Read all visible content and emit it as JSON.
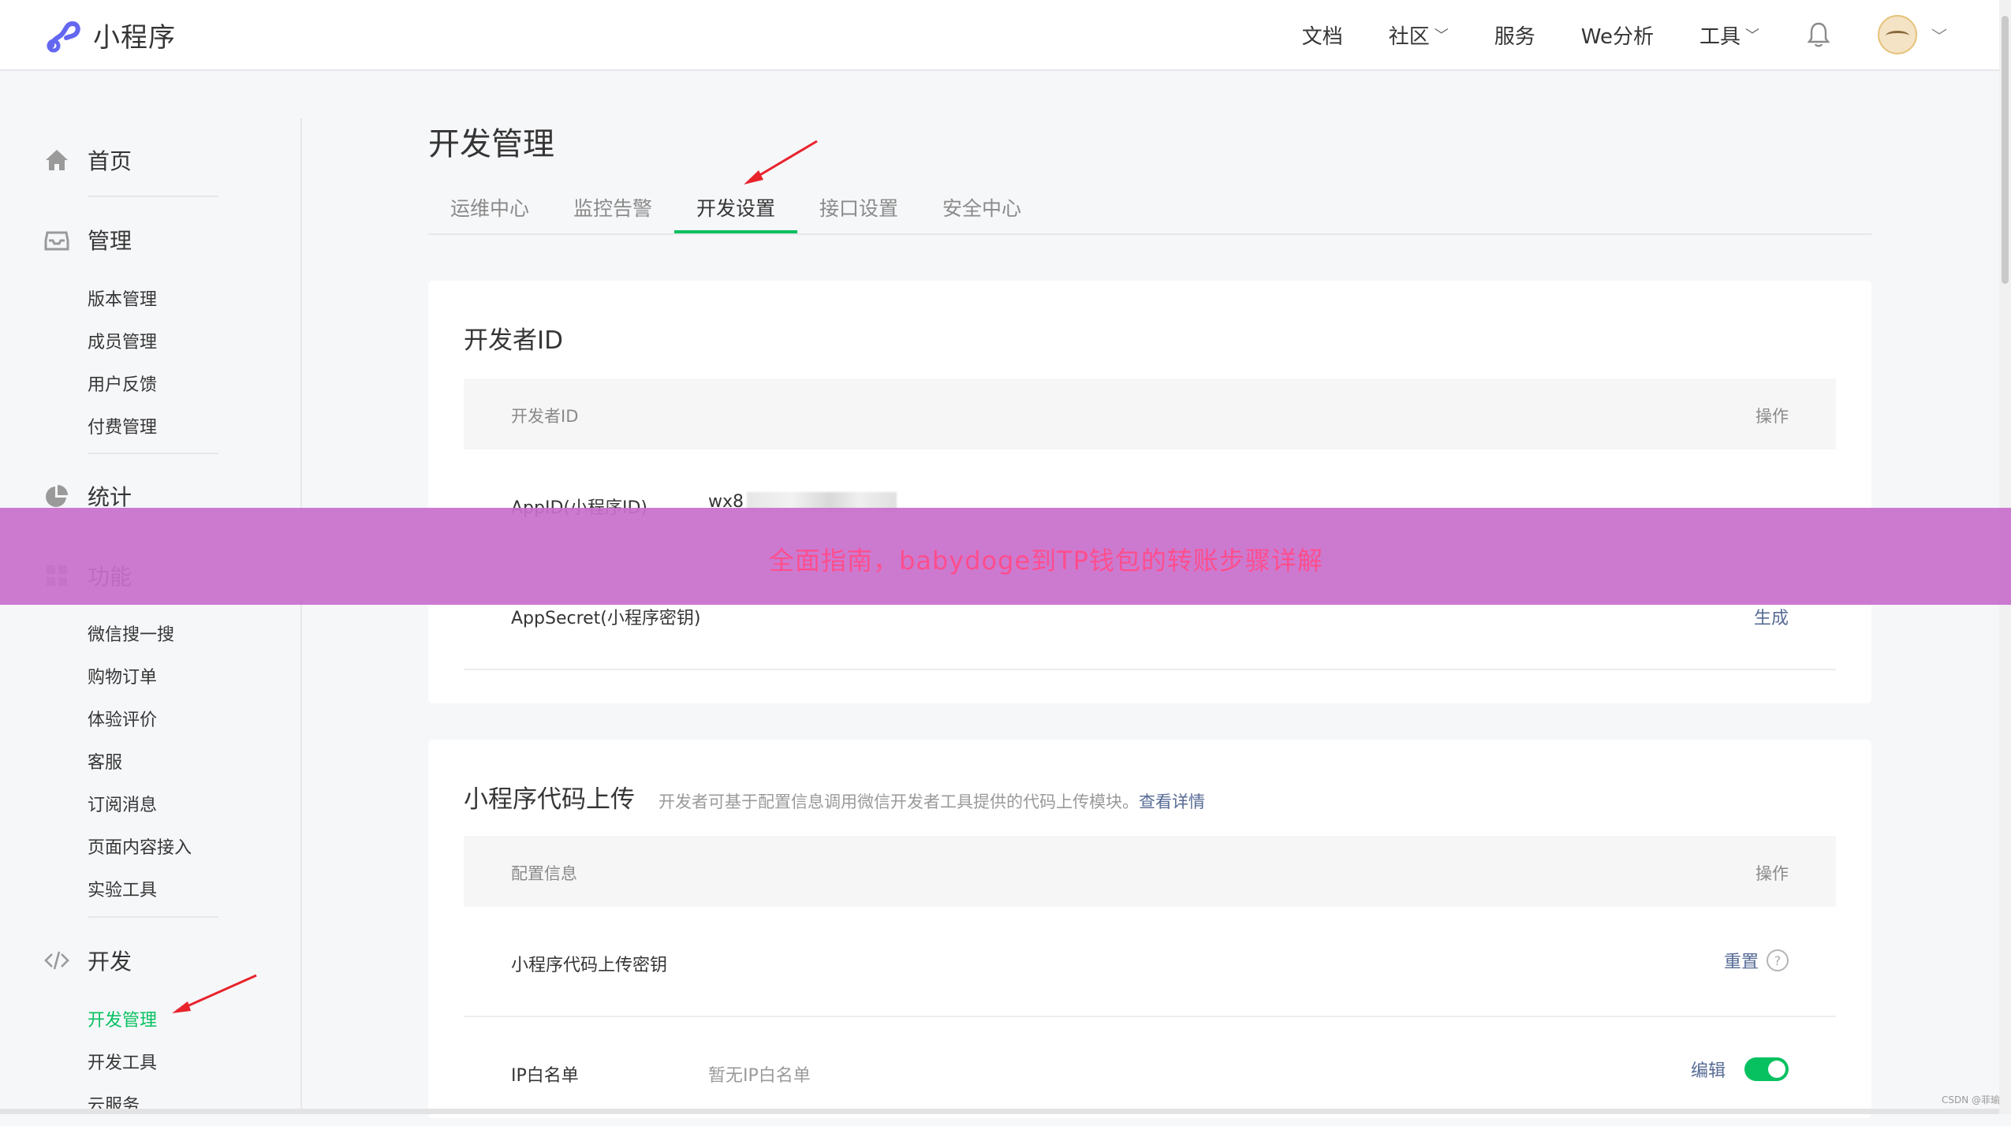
{
  "app": {
    "logo_text": "小程序"
  },
  "topnav": {
    "items": [
      {
        "label": "文档",
        "has_dropdown": false
      },
      {
        "label": "社区",
        "has_dropdown": true
      },
      {
        "label": "服务",
        "has_dropdown": false
      },
      {
        "label": "We分析",
        "has_dropdown": false
      },
      {
        "label": "工具",
        "has_dropdown": true
      }
    ],
    "bell_icon": "bell-icon",
    "avatar_icon": "avatar"
  },
  "sidebar": {
    "home": {
      "label": "首页",
      "icon": "home-icon"
    },
    "manage": {
      "label": "管理",
      "icon": "inbox-icon",
      "items": [
        "版本管理",
        "成员管理",
        "用户反馈",
        "付费管理"
      ]
    },
    "stats": {
      "label": "统计",
      "icon": "pie-chart-icon"
    },
    "features": {
      "label": "功能",
      "icon": "grid-icon",
      "items": [
        "微信搜一搜",
        "购物订单",
        "体验评价",
        "客服",
        "订阅消息",
        "页面内容接入",
        "实验工具"
      ]
    },
    "dev": {
      "label": "开发",
      "icon": "code-icon",
      "items": [
        "开发管理",
        "开发工具",
        "云服务"
      ],
      "active": "开发管理"
    }
  },
  "main": {
    "title": "开发管理",
    "tabs": [
      "运维中心",
      "监控告警",
      "开发设置",
      "接口设置",
      "安全中心"
    ],
    "active_tab": "开发设置",
    "developer_id": {
      "title": "开发者ID",
      "col_name": "开发者ID",
      "col_action": "操作",
      "appid_label": "AppID(小程序ID)",
      "appid_value": "wx8",
      "appsecret_label": "AppSecret(小程序密钥)",
      "appsecret_action": "生成"
    },
    "code_upload": {
      "title": "小程序代码上传",
      "desc": "开发者可基于配置信息调用微信开发者工具提供的代码上传模块。",
      "desc_link": "查看详情",
      "col_name": "配置信息",
      "col_action": "操作",
      "key_label": "小程序代码上传密钥",
      "key_action": "重置",
      "ip_label": "IP白名单",
      "ip_value": "暂无IP白名单",
      "ip_action": "编辑",
      "ip_toggle": true
    }
  },
  "overlay": {
    "banner_text": "全面指南，babydoge到TP钱包的转账步骤详解"
  },
  "watermark": "CSDN @菲瑜",
  "colors": {
    "accent": "#07c160",
    "link": "#576b95",
    "banner": "#c870cc",
    "arrow": "#e8232c"
  }
}
